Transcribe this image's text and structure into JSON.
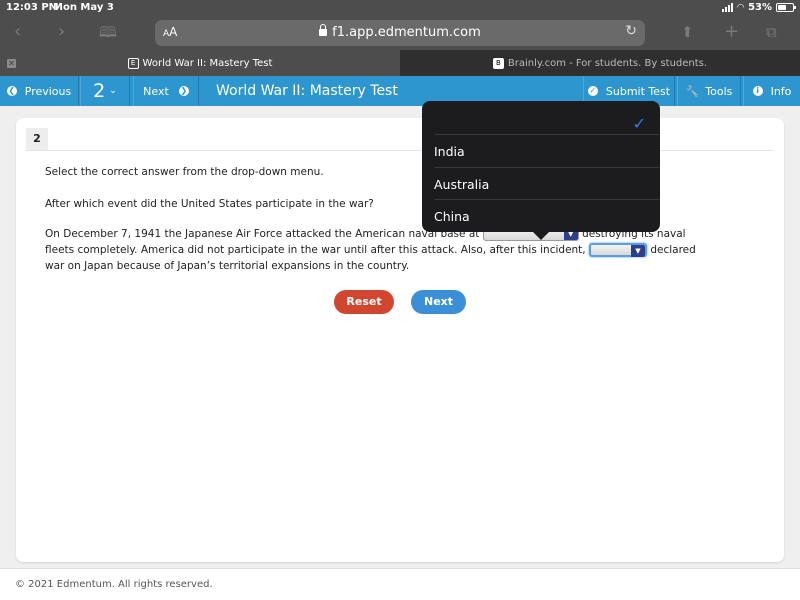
{
  "status_bar": {
    "time": "12:03 PM",
    "date": "Mon May 3",
    "battery_percent": "53%"
  },
  "browser": {
    "text_size_button": "AA",
    "url": "f1.app.edmentum.com",
    "icons": [
      "back-icon",
      "forward-icon",
      "bookmarks-icon",
      "reload-icon",
      "share-icon",
      "new-tab-icon",
      "tabs-icon"
    ],
    "tabs": [
      {
        "title": "World War II: Mastery Test",
        "favicon": "E",
        "active": true
      },
      {
        "title": "Brainly.com - For students. By students.",
        "favicon": "B",
        "active": false
      }
    ]
  },
  "app_bar": {
    "previous_label": "Previous",
    "question_selector": "2",
    "next_label": "Next",
    "title": "World War II: Mastery Test",
    "submit_label": "Submit Test",
    "tools_label": "Tools",
    "info_label": "Info",
    "color": "#2e96cf"
  },
  "question": {
    "number": "2",
    "instruction": "Select the correct answer from the drop-down menu.",
    "prompt": "After which event did the United States participate in the war?",
    "passage": {
      "part1": "On December 7, 1941 the Japanese Air Force attacked the American naval base at",
      "part2": "destroying its naval fleets completely. America did not participate in the war until after this attack. Also, after this incident,",
      "part3": "declared war on Japan because of Japan’s territorial expansions in the country."
    },
    "dropdown1_value": "",
    "dropdown2_value": ""
  },
  "dropdown_popover": {
    "selected_index": 0,
    "options": [
      "",
      "India",
      "Australia",
      "China"
    ]
  },
  "buttons": {
    "reset": "Reset",
    "next": "Next",
    "reset_color": "#d0462f",
    "next_color": "#3b8fd6"
  },
  "footer": {
    "copyright": "© 2021 Edmentum. All rights reserved."
  }
}
